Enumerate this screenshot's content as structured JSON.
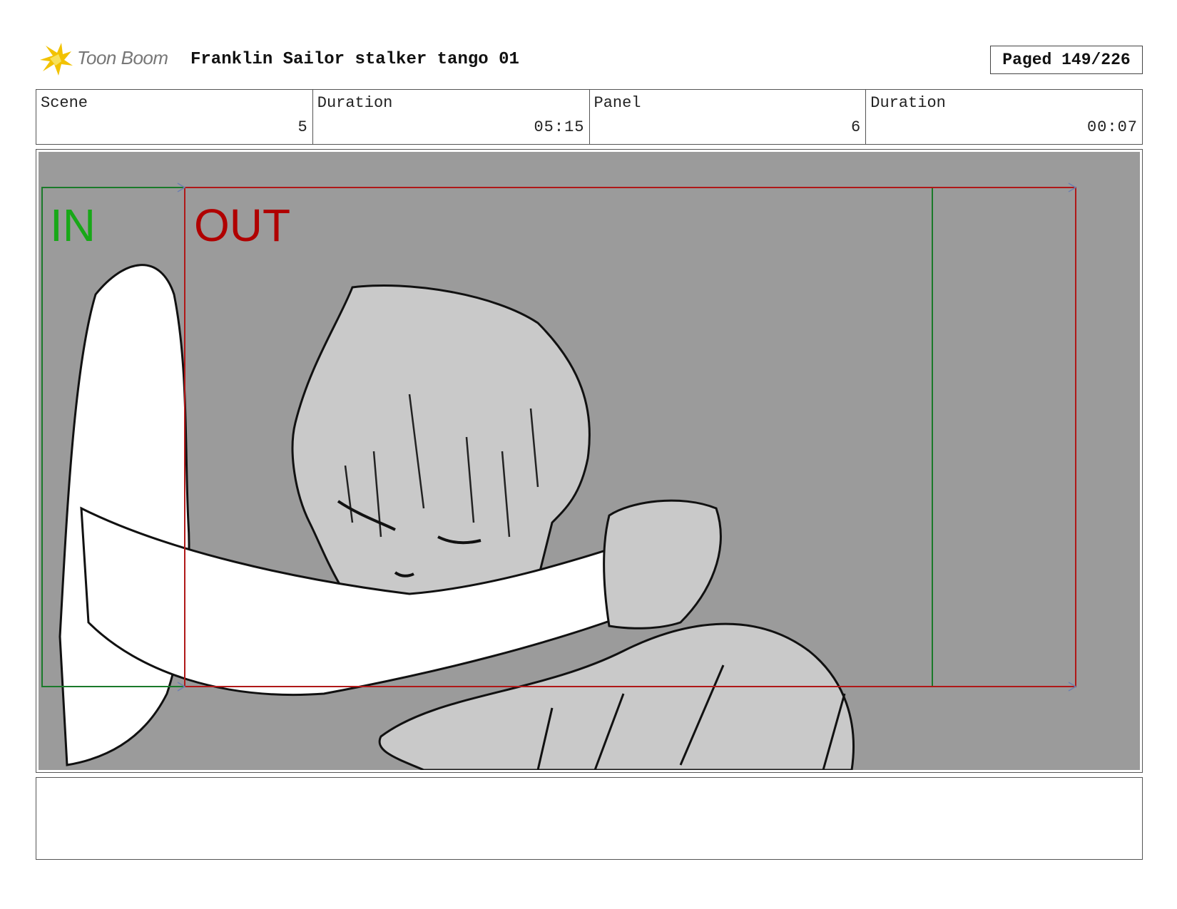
{
  "header": {
    "logo_text": "Toon Boom",
    "title": "Franklin Sailor stalker tango 01",
    "page_badge": "Paged 149/226"
  },
  "info": {
    "scene_label": "Scene",
    "scene_value": "5",
    "scene_duration_label": "Duration",
    "scene_duration_value": "05:15",
    "panel_label": "Panel",
    "panel_value": "6",
    "panel_duration_label": "Duration",
    "panel_duration_value": "00:07"
  },
  "panel": {
    "in_label": "IN",
    "out_label": "OUT",
    "colors": {
      "background": "#9b9b9b",
      "in_frame": "#1a7a2a",
      "in_text": "#18a818",
      "out_frame": "#b01818",
      "out_text": "#b00000",
      "skin": "#c9c9c9",
      "sleeve": "#ffffff"
    }
  },
  "notes": {
    "text": ""
  }
}
